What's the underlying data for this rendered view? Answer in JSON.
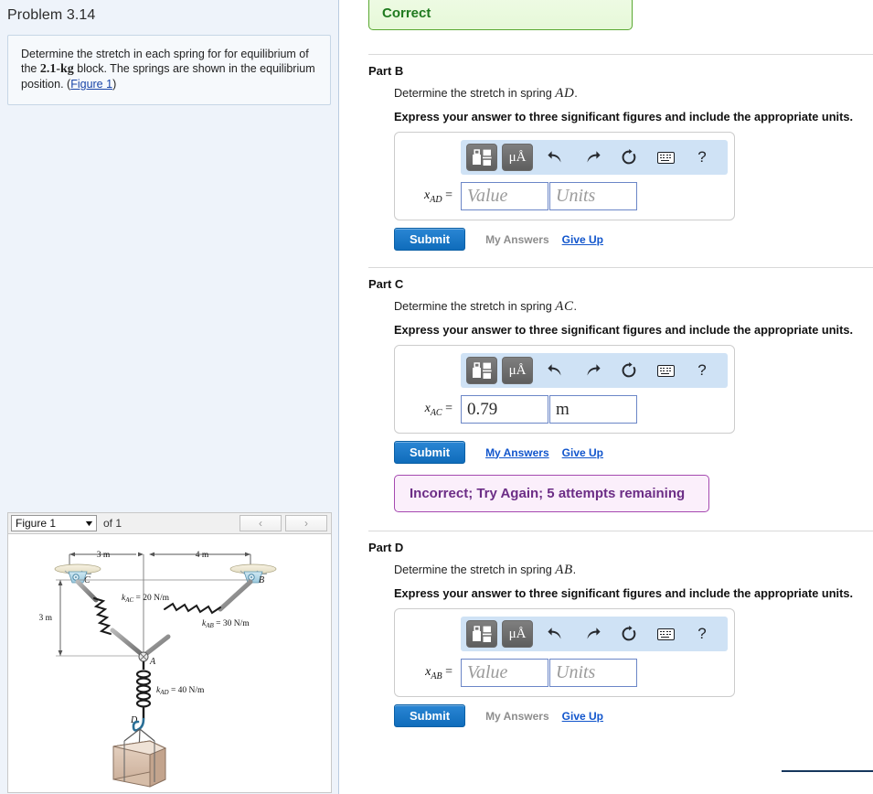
{
  "left": {
    "problem_title": "Problem 3.14",
    "problem_text_1": "Determine the stretch in each spring for for equilibrium of the ",
    "problem_text_kg": "2.1-kg",
    "problem_text_2": " block. The springs are shown in the equilibrium position. (",
    "figure_link": "Figure 1",
    "problem_text_3": ")",
    "figure_widget": {
      "selected_figure": "Figure 1",
      "of_label": "of 1",
      "prev_icon": "chevron-left-icon",
      "next_icon": "chevron-right-icon",
      "caret_icon": "chevron-down-icon"
    },
    "figure": {
      "dim_top_left": "3 m",
      "dim_top_right": "4 m",
      "dim_left": "3 m",
      "label_c": "C",
      "label_b": "B",
      "label_a": "A",
      "label_d": "D",
      "k_ac": "k",
      "k_ac_sub": "AC",
      "k_ac_val": " = 20 N/m",
      "k_ab": "k",
      "k_ab_sub": "AB",
      "k_ab_val": " = 30 N/m",
      "k_ad": "k",
      "k_ad_sub": "AD",
      "k_ad_val": " = 40 N/m"
    }
  },
  "toolbar": {
    "template_icon": "math-template-icon",
    "units_icon": "micro-angstrom-units-icon",
    "units_label": "μÅ",
    "undo_icon": "undo-arrow-icon",
    "redo_icon": "redo-arrow-icon",
    "reset_icon": "reset-circle-arrow-icon",
    "keyboard_icon": "keyboard-icon",
    "help_icon": "question-mark-icon",
    "help_label": "?"
  },
  "banners": {
    "correct": "Correct",
    "incorrect": "Incorrect; Try Again; 5 attempts remaining"
  },
  "common": {
    "instruction": "Express your answer to three significant figures and include the appropriate units.",
    "submit_label": "Submit",
    "my_answers_label": "My Answers",
    "give_up_label": "Give Up",
    "value_placeholder": "Value",
    "units_placeholder": "Units"
  },
  "parts": {
    "b": {
      "heading": "Part B",
      "question_prefix": "Determine the stretch in spring ",
      "question_var": "AD",
      "question_suffix": ".",
      "var_base": "x",
      "var_sub": "AD",
      "eq": "=",
      "value": "",
      "units": "",
      "my_answers_enabled": false
    },
    "c": {
      "heading": "Part C",
      "question_prefix": "Determine the stretch in spring ",
      "question_var": "AC",
      "question_suffix": ".",
      "var_base": "x",
      "var_sub": "AC",
      "eq": "=",
      "value": "0.79",
      "units": "m",
      "my_answers_enabled": true
    },
    "d": {
      "heading": "Part D",
      "question_prefix": "Determine the stretch in spring ",
      "question_var": "AB",
      "question_suffix": ".",
      "var_base": "x",
      "var_sub": "AB",
      "eq": "=",
      "value": "",
      "units": "",
      "my_answers_enabled": false
    }
  },
  "colors": {
    "accent_blue": "#1155cc",
    "submit_blue": "#0f6cbb",
    "correct_green": "#1f7a1f",
    "incorrect_purple": "#6c2d86",
    "panel_bg": "#eef3fa",
    "toolbar_blue": "#cfe2f5"
  }
}
